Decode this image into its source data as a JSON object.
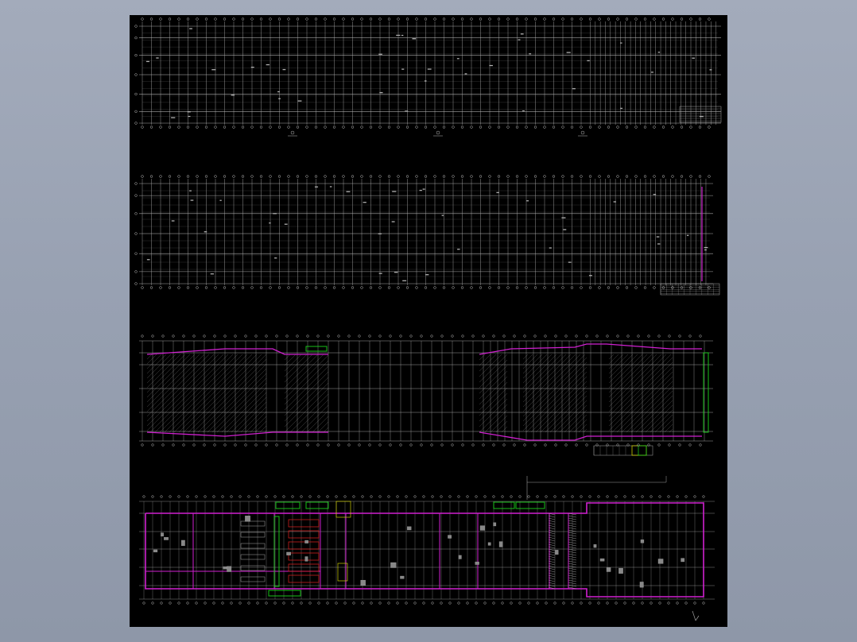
{
  "viewer": {
    "background_color": "#9aa3b3",
    "drawing_background": "#000000"
  },
  "drawing": {
    "line_color": "#b8b8b8",
    "accent_magenta": "#d020d0",
    "accent_green": "#19d419",
    "accent_yellow": "#e0e000",
    "accent_red": "#e02020",
    "panels": [
      {
        "id": "plan-1",
        "kind": "structural-grid"
      },
      {
        "id": "plan-2",
        "kind": "structural-grid"
      },
      {
        "id": "plan-3",
        "kind": "zoned-plan"
      },
      {
        "id": "plan-4",
        "kind": "floor-layout"
      }
    ]
  }
}
